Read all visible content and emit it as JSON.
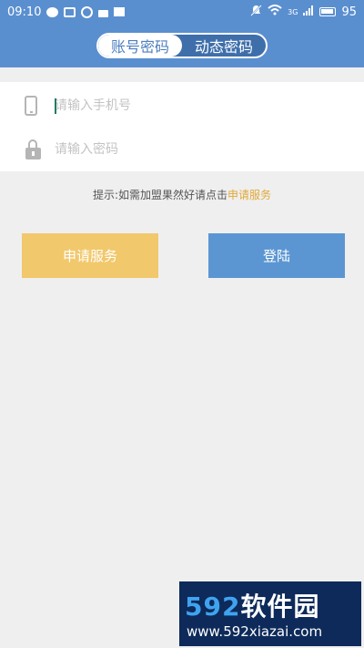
{
  "status_bar": {
    "time": "09:10",
    "signal_label": "3G",
    "battery": "95"
  },
  "tabs": [
    {
      "label": "账号密码",
      "active": true
    },
    {
      "label": "动态密码",
      "active": false
    }
  ],
  "form": {
    "phone_placeholder": "请输入手机号",
    "password_placeholder": "请输入密码"
  },
  "tip": {
    "text": "提示:如需加盟果然好请点击",
    "link": "申请服务"
  },
  "buttons": {
    "apply": "申请服务",
    "login": "登陆"
  },
  "watermark": {
    "num": "592",
    "name": "软件园",
    "url": "www.592xiazai.com"
  },
  "colors": {
    "primary": "#5a8fcf",
    "apply": "#f1c86c",
    "login": "#5b96d2",
    "tip_link": "#e2a93a"
  }
}
